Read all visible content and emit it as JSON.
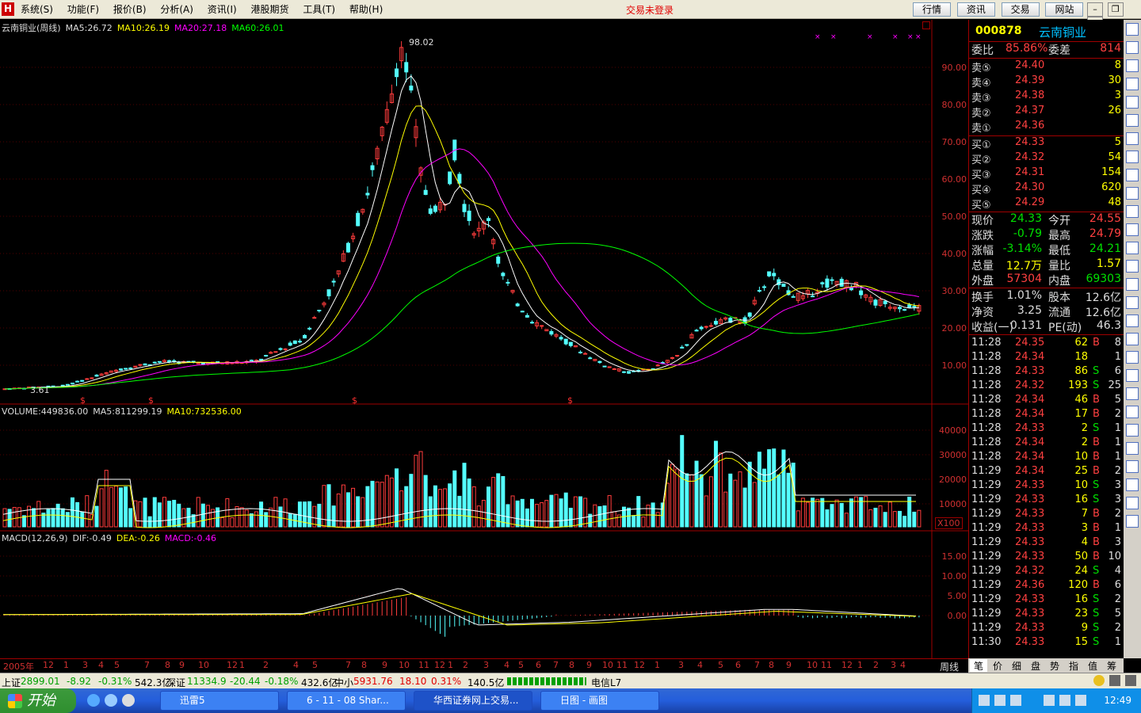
{
  "menubar": {
    "logo": "H",
    "menus": [
      "系统(S)",
      "功能(F)",
      "报价(B)",
      "分析(A)",
      "资讯(I)",
      "港股期货",
      "工具(T)",
      "帮助(H)"
    ],
    "trade_status": "交易未登录",
    "quick_buttons": [
      "行情",
      "资讯",
      "交易",
      "网站"
    ]
  },
  "chart": {
    "main_header": {
      "name": "云南铜业(周线)",
      "ma5": "MA5:26.72",
      "ma10": "MA10:26.19",
      "ma20": "MA20:27.18",
      "ma60": "MA60:26.01"
    },
    "peak_label": "98.02",
    "low_label": "3.61",
    "price_axis": [
      "90.00",
      "80.00",
      "70.00",
      "60.00",
      "50.00",
      "40.00",
      "30.00",
      "20.00",
      "10.00"
    ],
    "volume_header": {
      "vol": "VOLUME:449836.00",
      "ma5": "MA5:811299.19",
      "ma10": "MA10:732536.00"
    },
    "volume_axis": [
      "40000",
      "30000",
      "20000",
      "10000"
    ],
    "volume_unit": "X100",
    "macd_header": {
      "name": "MACD(12,26,9)",
      "dif": "DIF:-0.49",
      "dea": "DEA:-0.26",
      "macd": "MACD:-0.46"
    },
    "macd_axis": [
      "15.00",
      "10.00",
      "5.00",
      "0.00"
    ],
    "time_axis": [
      "2005年",
      "12",
      "1",
      "3",
      "4",
      "5",
      "7",
      "8",
      "9",
      "10",
      "12",
      "1",
      "2",
      "4",
      "5",
      "7",
      "8",
      "9",
      "10",
      "11",
      "12",
      "1",
      "2",
      "3",
      "4",
      "5",
      "6",
      "7",
      "8",
      "9",
      "10",
      "11",
      "12",
      "1",
      "3",
      "4",
      "5",
      "6",
      "7",
      "8",
      "9",
      "10",
      "11",
      "12",
      "1",
      "2",
      "3",
      "4"
    ],
    "period": "周线",
    "colors": {
      "up": "#ff3c3c",
      "down": "#54ffff",
      "ma5": "#ffffff",
      "ma10": "#ffff00",
      "ma20": "#ff00ff",
      "ma60": "#00ff00"
    }
  },
  "quote": {
    "code": "000878",
    "name": "云南铜业",
    "weibi_label": "委比",
    "weibi": "85.86%",
    "weicha_label": "委差",
    "weicha": "814",
    "asks": [
      {
        "label": "卖⑤",
        "price": "24.40",
        "vol": "8"
      },
      {
        "label": "卖④",
        "price": "24.39",
        "vol": "30"
      },
      {
        "label": "卖③",
        "price": "24.38",
        "vol": "3"
      },
      {
        "label": "卖②",
        "price": "24.37",
        "vol": "26"
      },
      {
        "label": "卖①",
        "price": "24.36",
        "vol": ""
      }
    ],
    "bids": [
      {
        "label": "买①",
        "price": "24.33",
        "vol": "5"
      },
      {
        "label": "买②",
        "price": "24.32",
        "vol": "54"
      },
      {
        "label": "买③",
        "price": "24.31",
        "vol": "154"
      },
      {
        "label": "买④",
        "price": "24.30",
        "vol": "620"
      },
      {
        "label": "买⑤",
        "price": "24.29",
        "vol": "48"
      }
    ],
    "stats": [
      {
        "l1": "现价",
        "v1": "24.33",
        "l2": "今开",
        "v2": "24.55"
      },
      {
        "l1": "涨跌",
        "v1": "-0.79",
        "l2": "最高",
        "v2": "24.79"
      },
      {
        "l1": "涨幅",
        "v1": "-3.14%",
        "l2": "最低",
        "v2": "24.21"
      },
      {
        "l1": "总量",
        "v1": "12.7万",
        "l2": "量比",
        "v2": "1.57"
      },
      {
        "l1": "外盘",
        "v1": "57304",
        "l2": "内盘",
        "v2": "69303"
      },
      {
        "l1": "换手",
        "v1": "1.01%",
        "l2": "股本",
        "v2": "12.6亿"
      },
      {
        "l1": "净资",
        "v1": "3.25",
        "l2": "流通",
        "v2": "12.6亿"
      },
      {
        "l1": "收益(一)",
        "v1": "0.131",
        "l2": "PE(动)",
        "v2": "46.3"
      }
    ],
    "ticks": [
      {
        "t": "11:28",
        "p": "24.35",
        "v": "62",
        "d": "B",
        "n": "8"
      },
      {
        "t": "11:28",
        "p": "24.34",
        "v": "18",
        "d": "",
        "n": "1"
      },
      {
        "t": "11:28",
        "p": "24.33",
        "v": "86",
        "d": "S",
        "n": "6"
      },
      {
        "t": "11:28",
        "p": "24.32",
        "v": "193",
        "d": "S",
        "n": "25"
      },
      {
        "t": "11:28",
        "p": "24.34",
        "v": "46",
        "d": "B",
        "n": "5"
      },
      {
        "t": "11:28",
        "p": "24.34",
        "v": "17",
        "d": "B",
        "n": "2"
      },
      {
        "t": "11:28",
        "p": "24.33",
        "v": "2",
        "d": "S",
        "n": "1"
      },
      {
        "t": "11:28",
        "p": "24.34",
        "v": "2",
        "d": "B",
        "n": "1"
      },
      {
        "t": "11:28",
        "p": "24.34",
        "v": "10",
        "d": "B",
        "n": "1"
      },
      {
        "t": "11:29",
        "p": "24.34",
        "v": "25",
        "d": "B",
        "n": "2"
      },
      {
        "t": "11:29",
        "p": "24.33",
        "v": "10",
        "d": "S",
        "n": "3"
      },
      {
        "t": "11:29",
        "p": "24.33",
        "v": "16",
        "d": "S",
        "n": "3"
      },
      {
        "t": "11:29",
        "p": "24.33",
        "v": "7",
        "d": "B",
        "n": "2"
      },
      {
        "t": "11:29",
        "p": "24.33",
        "v": "3",
        "d": "B",
        "n": "1"
      },
      {
        "t": "11:29",
        "p": "24.33",
        "v": "4",
        "d": "B",
        "n": "3"
      },
      {
        "t": "11:29",
        "p": "24.33",
        "v": "50",
        "d": "B",
        "n": "10"
      },
      {
        "t": "11:29",
        "p": "24.32",
        "v": "24",
        "d": "S",
        "n": "4"
      },
      {
        "t": "11:29",
        "p": "24.36",
        "v": "120",
        "d": "B",
        "n": "6"
      },
      {
        "t": "11:29",
        "p": "24.33",
        "v": "16",
        "d": "S",
        "n": "2"
      },
      {
        "t": "11:29",
        "p": "24.33",
        "v": "23",
        "d": "S",
        "n": "5"
      },
      {
        "t": "11:29",
        "p": "24.33",
        "v": "9",
        "d": "S",
        "n": "2"
      },
      {
        "t": "11:30",
        "p": "24.33",
        "v": "15",
        "d": "S",
        "n": "1"
      }
    ],
    "tabs": [
      "笔",
      "价",
      "细",
      "盘",
      "势",
      "指",
      "值",
      "筹"
    ]
  },
  "status": {
    "sh_label": "上证",
    "sh_value": "2899.01",
    "sh_change": "-8.92",
    "sh_pct": "-0.31%",
    "sh_amount": "542.3亿",
    "sz_label": "深证",
    "sz_value": "11334.9",
    "sz_change": "-20.44",
    "sz_pct": "-0.18%",
    "sz_amount": "432.6亿",
    "zx_label": "中小",
    "zx_value": "5931.76",
    "zx_change": "18.10",
    "zx_pct": "0.31%",
    "zx_amount": "140.5亿",
    "network": "电信L7"
  },
  "taskbar": {
    "start": "开始",
    "tasks": [
      "迅雷5",
      "6 - 11 - 08 Shar...",
      "华西证券网上交易...",
      "日图 - 画图"
    ],
    "clock": "12:49"
  }
}
